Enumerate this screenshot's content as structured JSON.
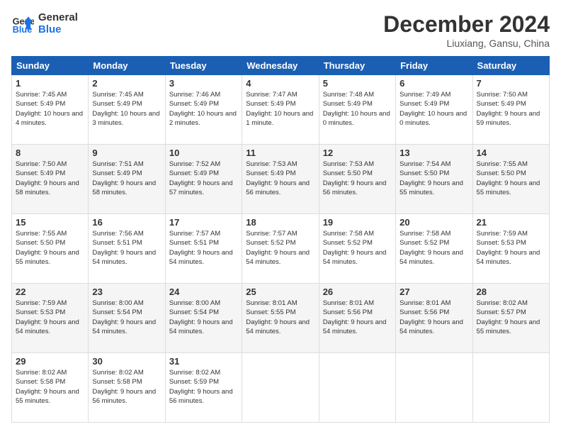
{
  "header": {
    "logo_line1": "General",
    "logo_line2": "Blue",
    "month": "December 2024",
    "location": "Liuxiang, Gansu, China"
  },
  "weekdays": [
    "Sunday",
    "Monday",
    "Tuesday",
    "Wednesday",
    "Thursday",
    "Friday",
    "Saturday"
  ],
  "weeks": [
    [
      {
        "day": 1,
        "sunrise": "7:45 AM",
        "sunset": "5:49 PM",
        "daylight": "10 hours and 4 minutes."
      },
      {
        "day": 2,
        "sunrise": "7:45 AM",
        "sunset": "5:49 PM",
        "daylight": "10 hours and 3 minutes."
      },
      {
        "day": 3,
        "sunrise": "7:46 AM",
        "sunset": "5:49 PM",
        "daylight": "10 hours and 2 minutes."
      },
      {
        "day": 4,
        "sunrise": "7:47 AM",
        "sunset": "5:49 PM",
        "daylight": "10 hours and 1 minute."
      },
      {
        "day": 5,
        "sunrise": "7:48 AM",
        "sunset": "5:49 PM",
        "daylight": "10 hours and 0 minutes."
      },
      {
        "day": 6,
        "sunrise": "7:49 AM",
        "sunset": "5:49 PM",
        "daylight": "10 hours and 0 minutes."
      },
      {
        "day": 7,
        "sunrise": "7:50 AM",
        "sunset": "5:49 PM",
        "daylight": "9 hours and 59 minutes."
      }
    ],
    [
      {
        "day": 8,
        "sunrise": "7:50 AM",
        "sunset": "5:49 PM",
        "daylight": "9 hours and 58 minutes."
      },
      {
        "day": 9,
        "sunrise": "7:51 AM",
        "sunset": "5:49 PM",
        "daylight": "9 hours and 58 minutes."
      },
      {
        "day": 10,
        "sunrise": "7:52 AM",
        "sunset": "5:49 PM",
        "daylight": "9 hours and 57 minutes."
      },
      {
        "day": 11,
        "sunrise": "7:53 AM",
        "sunset": "5:49 PM",
        "daylight": "9 hours and 56 minutes."
      },
      {
        "day": 12,
        "sunrise": "7:53 AM",
        "sunset": "5:50 PM",
        "daylight": "9 hours and 56 minutes."
      },
      {
        "day": 13,
        "sunrise": "7:54 AM",
        "sunset": "5:50 PM",
        "daylight": "9 hours and 55 minutes."
      },
      {
        "day": 14,
        "sunrise": "7:55 AM",
        "sunset": "5:50 PM",
        "daylight": "9 hours and 55 minutes."
      }
    ],
    [
      {
        "day": 15,
        "sunrise": "7:55 AM",
        "sunset": "5:50 PM",
        "daylight": "9 hours and 55 minutes."
      },
      {
        "day": 16,
        "sunrise": "7:56 AM",
        "sunset": "5:51 PM",
        "daylight": "9 hours and 54 minutes."
      },
      {
        "day": 17,
        "sunrise": "7:57 AM",
        "sunset": "5:51 PM",
        "daylight": "9 hours and 54 minutes."
      },
      {
        "day": 18,
        "sunrise": "7:57 AM",
        "sunset": "5:52 PM",
        "daylight": "9 hours and 54 minutes."
      },
      {
        "day": 19,
        "sunrise": "7:58 AM",
        "sunset": "5:52 PM",
        "daylight": "9 hours and 54 minutes."
      },
      {
        "day": 20,
        "sunrise": "7:58 AM",
        "sunset": "5:52 PM",
        "daylight": "9 hours and 54 minutes."
      },
      {
        "day": 21,
        "sunrise": "7:59 AM",
        "sunset": "5:53 PM",
        "daylight": "9 hours and 54 minutes."
      }
    ],
    [
      {
        "day": 22,
        "sunrise": "7:59 AM",
        "sunset": "5:53 PM",
        "daylight": "9 hours and 54 minutes."
      },
      {
        "day": 23,
        "sunrise": "8:00 AM",
        "sunset": "5:54 PM",
        "daylight": "9 hours and 54 minutes."
      },
      {
        "day": 24,
        "sunrise": "8:00 AM",
        "sunset": "5:54 PM",
        "daylight": "9 hours and 54 minutes."
      },
      {
        "day": 25,
        "sunrise": "8:01 AM",
        "sunset": "5:55 PM",
        "daylight": "9 hours and 54 minutes."
      },
      {
        "day": 26,
        "sunrise": "8:01 AM",
        "sunset": "5:56 PM",
        "daylight": "9 hours and 54 minutes."
      },
      {
        "day": 27,
        "sunrise": "8:01 AM",
        "sunset": "5:56 PM",
        "daylight": "9 hours and 54 minutes."
      },
      {
        "day": 28,
        "sunrise": "8:02 AM",
        "sunset": "5:57 PM",
        "daylight": "9 hours and 55 minutes."
      }
    ],
    [
      {
        "day": 29,
        "sunrise": "8:02 AM",
        "sunset": "5:58 PM",
        "daylight": "9 hours and 55 minutes."
      },
      {
        "day": 30,
        "sunrise": "8:02 AM",
        "sunset": "5:58 PM",
        "daylight": "9 hours and 56 minutes."
      },
      {
        "day": 31,
        "sunrise": "8:02 AM",
        "sunset": "5:59 PM",
        "daylight": "9 hours and 56 minutes."
      },
      null,
      null,
      null,
      null
    ]
  ]
}
